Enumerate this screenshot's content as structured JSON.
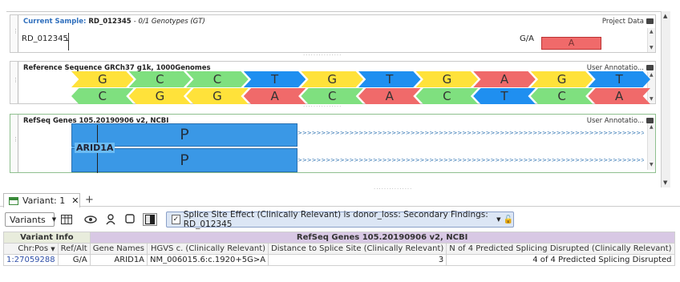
{
  "sample_panel": {
    "label": "Current Sample:",
    "name": "RD_012345",
    "genotypes": "- 0/1 Genotypes (GT)",
    "right": "Project Data",
    "row_label": "RD_012345",
    "allele": "G/A",
    "variant_box": "A"
  },
  "reference_panel": {
    "title": "Reference Sequence GRCh37 g1k, 1000Genomes",
    "right": "User Annotatio...",
    "top_strand": [
      "G",
      "C",
      "C",
      "T",
      "G",
      "T",
      "G",
      "A",
      "G",
      "T"
    ],
    "bottom_strand": [
      "C",
      "G",
      "G",
      "A",
      "C",
      "A",
      "C",
      "T",
      "C",
      "A"
    ],
    "colors": {
      "G": "#ffe23a",
      "C": "#7fe07f",
      "T": "#1f8ff0",
      "A": "#f06a6a"
    }
  },
  "refseq_panel": {
    "title": "RefSeq Genes 105.20190906 v2, NCBI",
    "right": "User Annotatio...",
    "gene": "ARID1A",
    "exon_label_1": "P",
    "exon_label_2": "P",
    "chevrons": ">>>>>>>>>>>>>>>>>>>>>>>>>>>>>>>>>>>>>>>>>>>>>>>>>>>>>>>>>>>>>>>>>>>>>>>>>>>>>>>"
  },
  "tabs": {
    "variant_tab": "Variant: 1",
    "close": "✕",
    "add": "+"
  },
  "toolbar": {
    "view_select": "Variants",
    "filter_text": "Splice Site Effect (Clinically Relevant) is donor_loss: Secondary Findings: RD_012345"
  },
  "table": {
    "group_headers": [
      "Variant Info",
      "RefSeq Genes 105.20190906 v2, NCBI"
    ],
    "columns": [
      "Chr:Pos",
      "Ref/Alt",
      "Gene Names",
      "HGVS c. (Clinically Relevant)",
      "Distance to Splice Site (Clinically Relevant)",
      "N of 4 Predicted Splicing Disrupted (Clinically Relevant)"
    ],
    "rows": [
      {
        "chrpos": "1:27059288",
        "refalt": "G/A",
        "gene": "ARID1A",
        "hgvs": "NM_006015.6:c.1920+5G>A",
        "distance": "3",
        "n_disrupted": "4 of 4 Predicted Splicing Disrupted"
      }
    ]
  }
}
